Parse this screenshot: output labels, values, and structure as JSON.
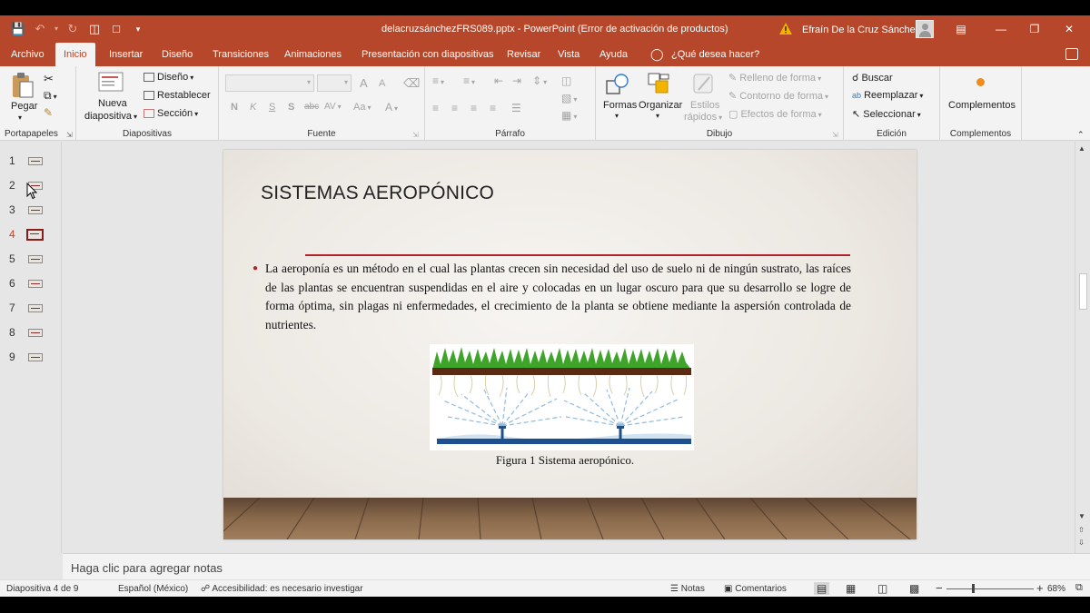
{
  "titlebar": {
    "document_title": "delacruzsánchezFRS089.pptx  -  PowerPoint (Error de activación de productos)",
    "user_name": "Efraín De la Cruz Sánchez"
  },
  "tabs": [
    "Archivo",
    "Inicio",
    "Insertar",
    "Diseño",
    "Transiciones",
    "Animaciones",
    "Presentación con diapositivas",
    "Revisar",
    "Vista",
    "Ayuda"
  ],
  "active_tab": "Inicio",
  "tell_me": "¿Qué desea hacer?",
  "ribbon": {
    "portapapeles": {
      "label": "Portapapeles",
      "paste": "Pegar"
    },
    "diapositivas": {
      "label": "Diapositivas",
      "new_slide_1": "Nueva",
      "new_slide_2": "diapositiva",
      "layout": "Diseño",
      "reset": "Restablecer",
      "section": "Sección"
    },
    "fuente": {
      "label": "Fuente",
      "bold": "N",
      "italic": "K",
      "underline": "S",
      "shadow": "S",
      "strike": "abc",
      "spacing": "AV",
      "case": "Aa",
      "grow": "A",
      "shrink": "A"
    },
    "parrafo": {
      "label": "Párrafo"
    },
    "dibujo": {
      "label": "Dibujo",
      "shapes": "Formas",
      "arrange": "Organizar",
      "quick_styles_1": "Estilos",
      "quick_styles_2": "rápidos",
      "fill": "Relleno de forma",
      "outline": "Contorno de forma",
      "effects": "Efectos de forma"
    },
    "edicion": {
      "label": "Edición",
      "find": "Buscar",
      "replace": "Reemplazar",
      "select": "Seleccionar"
    },
    "complementos": {
      "label": "Complementos",
      "addins": "Complementos"
    }
  },
  "thumbnails": [
    "1",
    "2",
    "3",
    "4",
    "5",
    "6",
    "7",
    "8",
    "9"
  ],
  "selected_slide": "4",
  "slide": {
    "title": "SISTEMAS AEROPÓNICO",
    "body": "La aeroponía es un método en el cual las plantas crecen sin necesidad del uso de suelo ni de ningún sustrato, las raíces de las plantas se encuentran suspendidas en el aire y colocadas en un lugar oscuro para que su desarrollo se logre de forma óptima, sin plagas ni enfermedades, el crecimiento de la planta se obtiene mediante la aspersión controlada de nutrientes.",
    "caption": "Figura  1 Sistema aeropónico."
  },
  "notes_placeholder": "Haga clic para agregar notas",
  "status": {
    "slide_of": "Diapositiva 4 de 9",
    "language": "Español (México)",
    "accessibility": "Accesibilidad: es necesario investigar",
    "notes": "Notas",
    "comments": "Comentarios",
    "zoom": "68%"
  },
  "colors": {
    "accent": "#b7472a",
    "title_rule": "#b3212b"
  }
}
